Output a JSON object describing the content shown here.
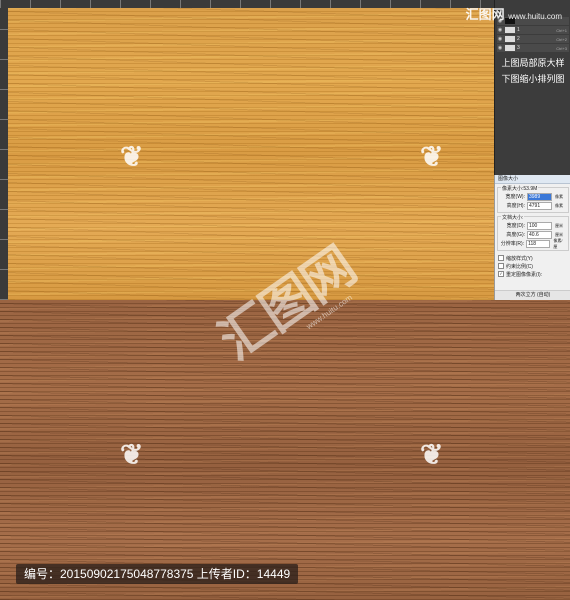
{
  "watermark": {
    "brand": "汇图网",
    "site": "www.huitu.com",
    "icon": "huitu-flame-icon"
  },
  "ps_panel": {
    "layers": [
      {
        "name": "",
        "shortcut": ""
      },
      {
        "name": "1",
        "shortcut": "Ctrl+1"
      },
      {
        "name": "2",
        "shortcut": "Ctrl+2"
      },
      {
        "name": "3",
        "shortcut": "Ctrl+3"
      }
    ],
    "note_line1": "上图局部原大样",
    "note_line2": "下图缩小排列图"
  },
  "dialog": {
    "title": "图像大小",
    "pixel_size_label": "像素大小:53.9M",
    "width_label": "宽度(W):",
    "width_value": "3989",
    "width_unit": "像素",
    "height_label": "高度(H):",
    "height_value": "4791",
    "height_unit": "像素",
    "doc_size_label": "文档大小:",
    "doc_width_label": "宽度(D):",
    "doc_width_value": "100",
    "doc_width_unit": "厘米",
    "doc_height_label": "高度(G):",
    "doc_height_value": "40.6",
    "doc_height_unit": "厘米",
    "resolution_label": "分辨率(R):",
    "resolution_value": "118",
    "resolution_unit": "像素/厘",
    "check1": "缩放样式(Y)",
    "check2": "约束比例(C)",
    "check3": "重定图像像素(I):",
    "footer": "两次立方 (自动)"
  },
  "info_bar": {
    "text": "编号：20150902175048778375 上传者ID：14449"
  }
}
